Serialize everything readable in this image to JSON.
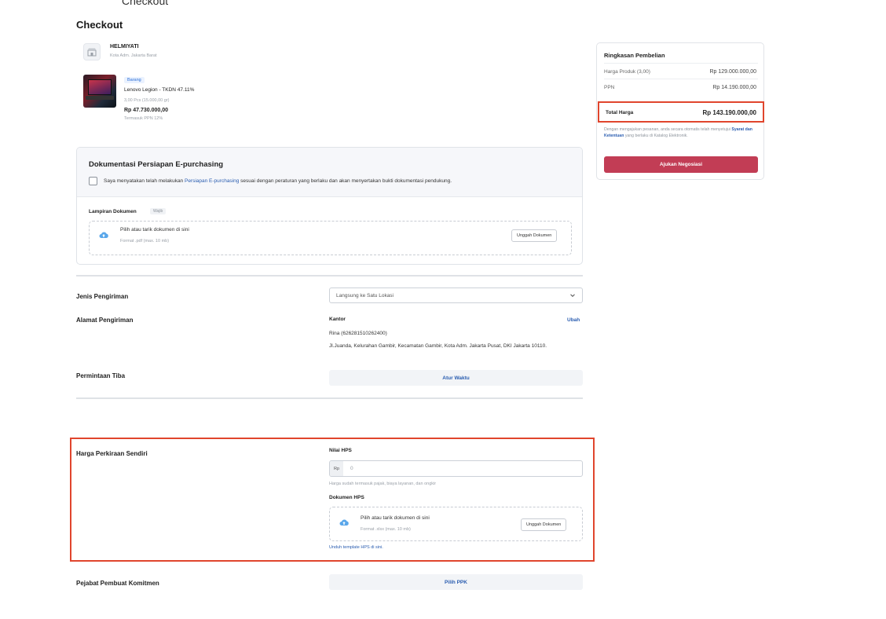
{
  "breadcrumb": {
    "current": "Checkout"
  },
  "page": {
    "title": "Checkout"
  },
  "seller": {
    "name": "HELMIYATI",
    "location": "Kota Adm. Jakarta Barat"
  },
  "product": {
    "badge": "Barang",
    "name": "Lenovo Legion - TKDN 47.11%",
    "quantity": "3,00 Pcs (15.000,00 gr)",
    "price": "Rp 47.730.000,00",
    "tax_note": "Termasuk PPN 12%"
  },
  "documentation": {
    "title": "Dokumentasi Persiapan E-purchasing",
    "statement_before": "Saya menyatakan telah melakukan ",
    "statement_link": "Persiapan E-purchasing",
    "statement_after": " sesuai dengan peraturan yang berlaku dan akan menyertakan bukti dokumentasi pendukung.",
    "checked": false,
    "attachment_label": "Lampiran Dokumen",
    "required_badge": "Wajib",
    "dropzone_title": "Pilih atau tarik dokumen di sini",
    "dropzone_format": "Format .pdf (max. 10 mb)",
    "upload_button": "Unggah Dokumen"
  },
  "shipping": {
    "type_label": "Jenis Pengiriman",
    "type_value": "Langsung ke Satu Lokasi",
    "address_label": "Alamat Pengiriman",
    "address_title": "Kantor",
    "edit_link": "Ubah",
    "recipient": "Rina (626281510262400)",
    "address": "Jl.Juanda, Kelurahan Gambir, Kecamatan Gambir, Kota Adm. Jakarta Pusat, DKI Jakarta 10110.",
    "arrival_label": "Permintaan Tiba",
    "arrival_button": "Atur Waktu"
  },
  "hps": {
    "section_label": "Harga Perkiraan Sendiri",
    "value_label": "Nilai HPS",
    "currency_prefix": "Rp",
    "value_placeholder": "0",
    "help": "Harga sudah termasuk pajak, biaya layanan, dan ongkir",
    "document_label": "Dokumen HPS",
    "dropzone_title": "Pilih atau tarik dokumen di sini",
    "dropzone_format": "Format .xlsx (max. 10 mb)",
    "upload_button": "Unggah Dokumen",
    "template_link": "Unduh template HPS di sini."
  },
  "ppk": {
    "label": "Pejabat Pembuat Komitmen",
    "button": "Pilih PPK"
  },
  "summary": {
    "title": "Ringkasan Pembelian",
    "product_label": "Harga Produk (3,00)",
    "product_value": "Rp 129.000.000,00",
    "tax_label": "PPN",
    "tax_value": "Rp 14.190.000,00",
    "total_label": "Total Harga",
    "total_value": "Rp 143.190.000,00",
    "note_before": "Dengan mengajukan pesanan, anda secara otomatis telah menyetujui ",
    "note_link": "Syarat dan Ketentuan",
    "note_after": " yang berlaku di Katalog Elektronik.",
    "submit_button": "Ajukan Negosiasi"
  },
  "colors": {
    "accent": "#c23d55",
    "link": "#2a5db0",
    "highlight": "#e0452d"
  },
  "icons": [
    "store-icon",
    "checkbox-icon",
    "cloud-upload-icon",
    "chevron-down-icon"
  ]
}
